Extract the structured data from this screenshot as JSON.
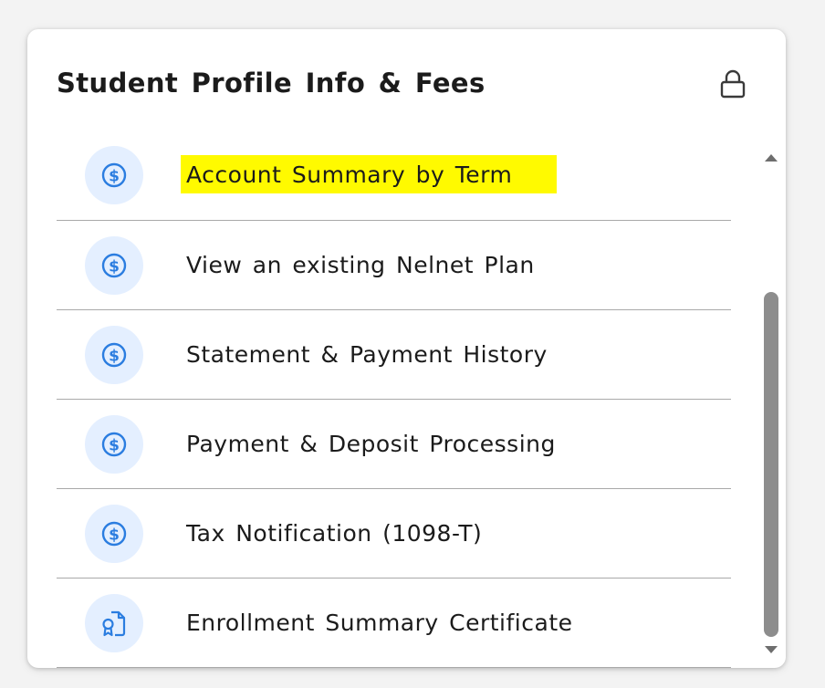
{
  "card": {
    "title": "Student Profile Info & Fees"
  },
  "icons": {
    "lock": "lock-icon",
    "dollar": "dollar-circle-icon",
    "certificate": "certificate-document-icon"
  },
  "colors": {
    "icon_accent": "#2b7de0",
    "icon_circle_bg": "#e4efff",
    "highlight": "#fffa00",
    "divider": "#a9a9a9"
  },
  "items": [
    {
      "label": "Account Summary by Term",
      "icon": "dollar-circle-icon",
      "highlighted": true
    },
    {
      "label": "View an existing Nelnet Plan",
      "icon": "dollar-circle-icon",
      "highlighted": false
    },
    {
      "label": "Statement & Payment History",
      "icon": "dollar-circle-icon",
      "highlighted": false
    },
    {
      "label": "Payment & Deposit Processing",
      "icon": "dollar-circle-icon",
      "highlighted": false
    },
    {
      "label": "Tax Notification (1098-T)",
      "icon": "dollar-circle-icon",
      "highlighted": false
    },
    {
      "label": "Enrollment Summary Certificate",
      "icon": "certificate-document-icon",
      "highlighted": false
    }
  ]
}
